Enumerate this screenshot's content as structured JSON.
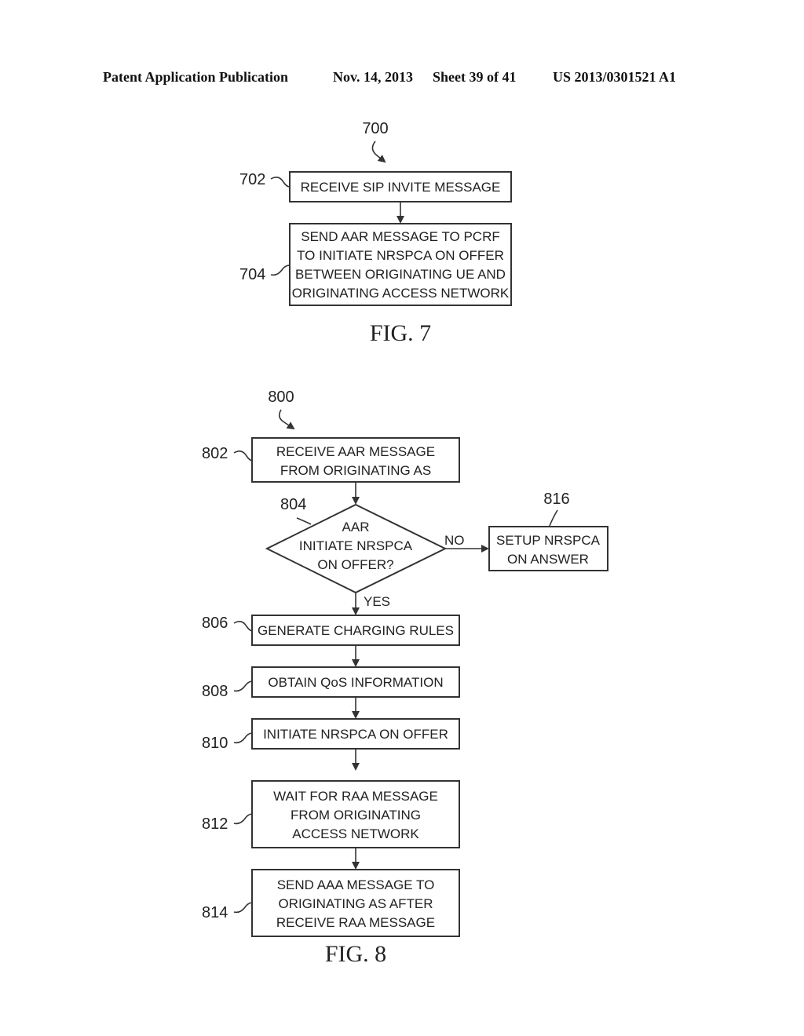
{
  "header": {
    "publication": "Patent Application Publication",
    "date": "Nov. 14, 2013",
    "sheet": "Sheet 39 of 41",
    "number": "US 2013/0301521 A1"
  },
  "fig7": {
    "ref": "700",
    "caption": "FIG. 7",
    "steps": [
      {
        "ref": "702",
        "lines": [
          "RECEIVE SIP INVITE MESSAGE"
        ]
      },
      {
        "ref": "704",
        "lines": [
          "SEND AAR MESSAGE TO PCRF",
          "TO INITIATE NRSPCA ON OFFER",
          "BETWEEN ORIGINATING UE AND",
          "ORIGINATING ACCESS NETWORK"
        ]
      }
    ]
  },
  "fig8": {
    "ref": "800",
    "caption": "FIG. 8",
    "steps": [
      {
        "ref": "802",
        "lines": [
          "RECEIVE AAR MESSAGE",
          "FROM ORIGINATING AS"
        ]
      },
      {
        "ref": "804",
        "lines": [
          "AAR",
          "INITIATE NRSPCA",
          "ON OFFER?"
        ]
      },
      {
        "ref": "806",
        "lines": [
          "GENERATE CHARGING RULES"
        ]
      },
      {
        "ref": "808",
        "lines": [
          "OBTAIN QoS INFORMATION"
        ]
      },
      {
        "ref": "810",
        "lines": [
          "INITIATE NRSPCA ON OFFER"
        ]
      },
      {
        "ref": "812",
        "lines": [
          "WAIT FOR RAA MESSAGE",
          "FROM ORIGINATING",
          "ACCESS NETWORK"
        ]
      },
      {
        "ref": "814",
        "lines": [
          "SEND AAA MESSAGE TO",
          "ORIGINATING AS AFTER",
          "RECEIVE RAA MESSAGE"
        ]
      },
      {
        "ref": "816",
        "lines": [
          "SETUP NRSPCA",
          "ON ANSWER"
        ]
      }
    ],
    "branch_no": "NO",
    "branch_yes": "YES"
  }
}
